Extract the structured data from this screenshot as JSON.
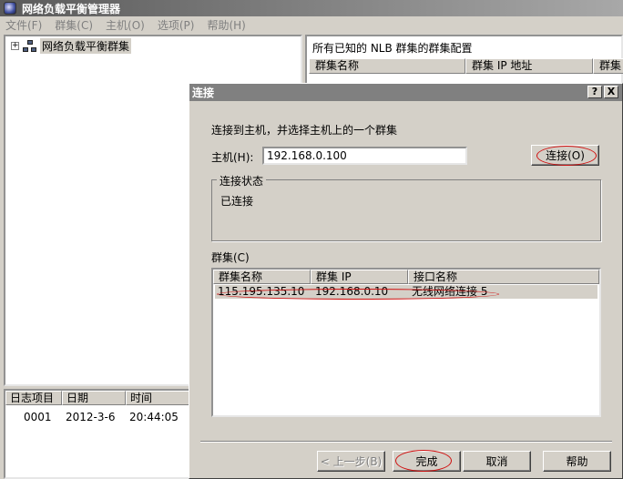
{
  "window": {
    "title": "网络负载平衡管理器"
  },
  "menu": [
    "文件(F)",
    "群集(C)",
    "主机(O)",
    "选项(P)",
    "帮助(H)"
  ],
  "tree": {
    "root_label": "网络负载平衡群集",
    "expander": "+"
  },
  "right_pane": {
    "header": "所有已知的 NLB 群集的群集配置",
    "columns": [
      "群集名称",
      "群集 IP 地址",
      "群集"
    ]
  },
  "log": {
    "columns": [
      "日志项目",
      "日期",
      "时间"
    ],
    "rows": [
      {
        "item": "0001",
        "date": "2012-3-6",
        "time": "20:44:05"
      }
    ]
  },
  "dialog": {
    "title": "连接",
    "help_btn": "?",
    "close_btn": "X",
    "instruction": "连接到主机，并选择主机上的一个群集",
    "host_label": "主机(H):",
    "host_value": "192.168.0.100",
    "connect_btn": "连接(O)",
    "status_group": "连接状态",
    "status_text": "已连接",
    "clusters_label": "群集(C)",
    "cluster_columns": [
      "群集名称",
      "群集 IP",
      "接口名称"
    ],
    "cluster_rows": [
      {
        "name": "115.195.135.10",
        "ip": "192.168.0.10",
        "iface": "无线网络连接 5"
      }
    ],
    "back_btn": "< 上一步(B)",
    "finish_btn": "完成",
    "cancel_btn": "取消",
    "help_btn2": "帮助"
  },
  "colors": {
    "annotation": "#d01010",
    "titlebar_inactive": "#808080"
  }
}
